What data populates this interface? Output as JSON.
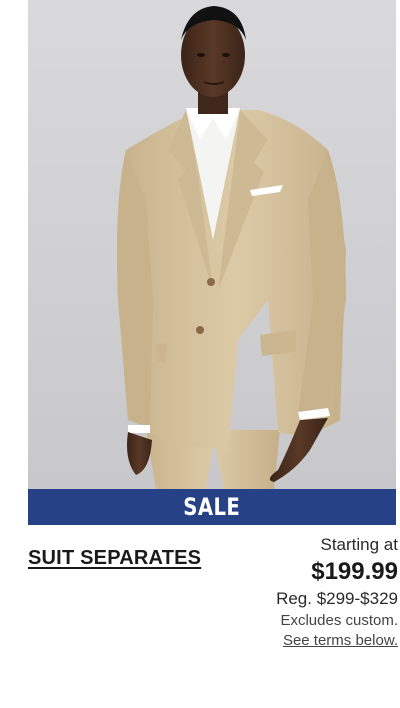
{
  "product": {
    "badge": "SALE",
    "title": "SUIT SEPARATES",
    "starting_label": "Starting at",
    "price": "$199.99",
    "regular_price": "Reg. $299-$329",
    "excludes_note": "Excludes custom.",
    "terms_link": "See terms below."
  },
  "colors": {
    "banner": "#274186",
    "suit": "#d8c6a3",
    "background": "#d3d3d6"
  }
}
